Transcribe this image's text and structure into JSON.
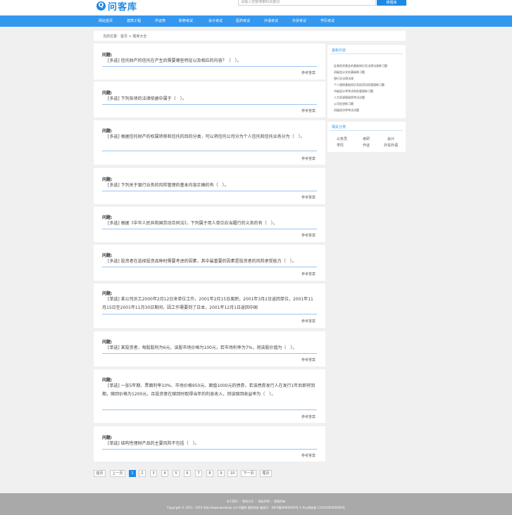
{
  "header": {
    "logo_mark": "Q",
    "logo_text": "问客库",
    "search_placeholder": "请输入您要搜索的关键词",
    "search_button": "搜题库"
  },
  "nav": [
    "网站首页",
    "建筑工程",
    "作证类",
    "职称考试",
    "会计考试",
    "医药考试",
    "外语考试",
    "外贸考试",
    "学历考试"
  ],
  "breadcrumb": "当前位置：首页 > 题库大全",
  "questions": [
    {
      "title": "问题:",
      "body": "[多选] 信托财产的信托在产生后需要哪些特征以及相应的内容？（　）。",
      "ref": "参考答案"
    },
    {
      "title": "问题:",
      "body": "[多选] 下列各项的法律依据中属于（　）。",
      "ref": "参考答案"
    },
    {
      "title": "问题:",
      "body": "[多选] 根据信托财产的权属转移和信托的目的分类，可以将信托公司分为个人信托和信托业务分为（　）。",
      "ref": "参考答案"
    },
    {
      "title": "问题:",
      "body": "[多选] 下列关于银行业务的风险管理的基本内容正确的有（　）。",
      "ref": "参考答案"
    },
    {
      "title": "问题:",
      "body": "[多选] 根据《中华人民共和国劳动合同法》，下列属于用人单位应当履行的义务的有（　）。",
      "ref": "参考答案"
    },
    {
      "title": "问题:",
      "body": "[多选] 投资者在选择投资品种时需要考虑的因素，其中最重要的因素是投资者的风险承受能力（　）。",
      "ref": "参考答案"
    },
    {
      "title": "问题:",
      "body": "[单选] 某公司员工2000年2月12日来单位工作，2001年2月15日离职，2001年3月2日返回单位，2001年11月15日至2001年11月30日期间，因工作需要到了日本，2001年12月1日返回中国",
      "ref": "参考答案"
    },
    {
      "title": "问题:",
      "body": "[单选] 某投资者，每股股利为6元，该股市场价格为100元，若市场利率为7%，则该股价值为（　）。",
      "ref": "参考答案"
    },
    {
      "title": "问题:",
      "body": "[单选] 一张5年期、票面利率10%、市场价格950元、面值1000元的债券，若该债券发行人在发行1年后即将到期，赎回价格为1200元，且投资者在赎回时取得当年的利息收入，则该赎回收益率为（　）。",
      "ref": "参考答案"
    },
    {
      "title": "问题:",
      "body": "[单选] 结构性理财产品的主要风险不包括（　）。",
      "ref": "参考答案"
    }
  ],
  "sidebar": {
    "recent_title": "最新内容",
    "recent_items": [
      "证券投资基金的基础知识及法律法规练习题",
      "初级会计实务基础练习题",
      "银行业法律法规",
      "个人理财基础知识及投资风险管理练习题",
      "中级会计师考试财务管理练习题",
      "人力资源管理师考试试题",
      "公司信贷练习题",
      "初级经济师考试试题"
    ],
    "category_title": "相关分类",
    "categories": [
      "公务员",
      "考研",
      "会计",
      "学历",
      "作证",
      "外贸外语"
    ]
  },
  "pager": [
    "首页",
    "上一页",
    "1",
    "2",
    "3",
    "4",
    "5",
    "6",
    "7",
    "8",
    "9",
    "10",
    "下一页",
    "尾页"
  ],
  "footer": {
    "links": "关于我们 ｜ 联系方式 ｜ 隐私声明 ｜ 版权所有",
    "copyright": "Copyright © 2013 - 2019 http://www.wenkuku.net 问客库 版权所有 备案号：京ICP备00000000号-1 京公网安备 11010102000000号"
  }
}
